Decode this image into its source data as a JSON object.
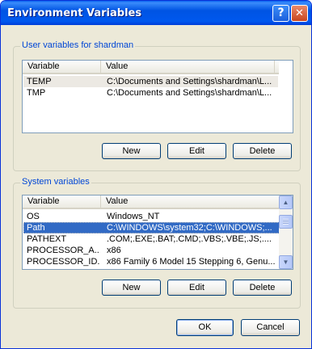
{
  "window": {
    "title": "Environment Variables"
  },
  "user_vars": {
    "legend": "User variables for shardman",
    "columns": [
      "Variable",
      "Value"
    ],
    "rows": [
      {
        "name": "TEMP",
        "value": "C:\\Documents and Settings\\shardman\\L..."
      },
      {
        "name": "TMP",
        "value": "C:\\Documents and Settings\\shardman\\L..."
      }
    ],
    "buttons": {
      "new": "New",
      "edit": "Edit",
      "delete": "Delete"
    }
  },
  "system_vars": {
    "legend": "System variables",
    "columns": [
      "Variable",
      "Value"
    ],
    "rows": [
      {
        "name": "OS",
        "value": "Windows_NT"
      },
      {
        "name": "Path",
        "value": "C:\\WINDOWS\\system32;C:\\WINDOWS;..."
      },
      {
        "name": "PATHEXT",
        "value": ".COM;.EXE;.BAT;.CMD;.VBS;.VBE;.JS;...."
      },
      {
        "name": "PROCESSOR_A...",
        "value": "x86"
      },
      {
        "name": "PROCESSOR_ID...",
        "value": "x86 Family 6 Model 15 Stepping 6, Genu..."
      }
    ],
    "selected_row": "Path",
    "buttons": {
      "new": "New",
      "edit": "Edit",
      "delete": "Delete"
    }
  },
  "dialog_buttons": {
    "ok": "OK",
    "cancel": "Cancel"
  },
  "icons": {
    "help": "help-icon",
    "close": "close-icon",
    "scroll_up": "scroll-up-arrow-icon",
    "scroll_down": "scroll-down-arrow-icon"
  },
  "colors": {
    "titlebar": "#0054e3",
    "selection": "#316ac5",
    "legend": "#0046d5",
    "dialog_bg": "#ece9d8"
  }
}
